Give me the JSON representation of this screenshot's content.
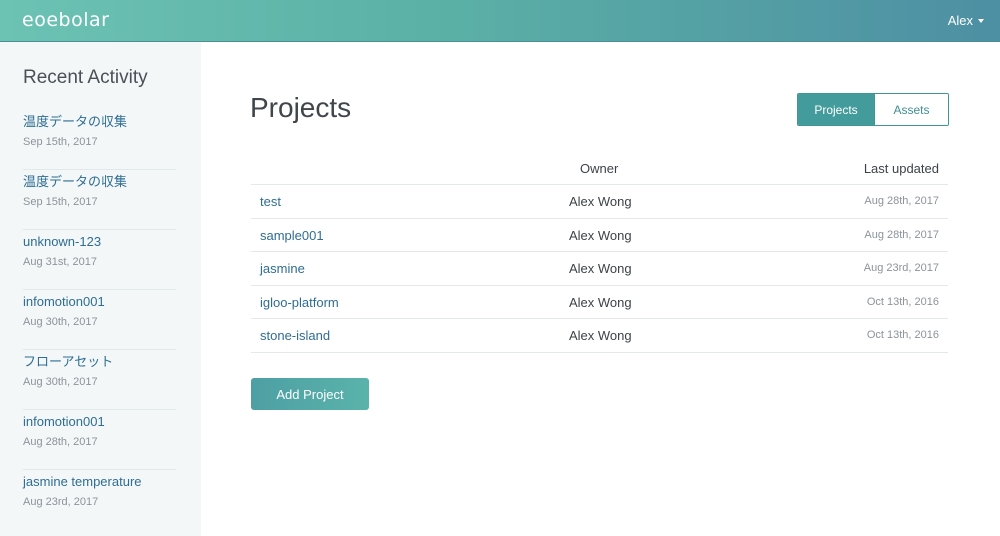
{
  "header": {
    "logo": "eoebolar",
    "user": "Alex"
  },
  "sidebar": {
    "title": "Recent Activity",
    "items": [
      {
        "name": "温度データの収集",
        "date": "Sep 15th, 2017"
      },
      {
        "name": "温度データの収集",
        "date": "Sep 15th, 2017"
      },
      {
        "name": "unknown-123",
        "date": "Aug 31st, 2017"
      },
      {
        "name": "infomotion001",
        "date": "Aug 30th, 2017"
      },
      {
        "name": "フローアセット",
        "date": "Aug 30th, 2017"
      },
      {
        "name": "infomotion001",
        "date": "Aug 28th, 2017"
      },
      {
        "name": "jasmine temperature",
        "date": "Aug 23rd, 2017"
      }
    ]
  },
  "main": {
    "title": "Projects",
    "toggle": {
      "projects": "Projects",
      "assets": "Assets",
      "active": "Projects"
    },
    "table": {
      "columns": {
        "owner": "Owner",
        "updated": "Last updated"
      },
      "rows": [
        {
          "name": "test",
          "owner": "Alex Wong",
          "updated": "Aug 28th, 2017"
        },
        {
          "name": "sample001",
          "owner": "Alex Wong",
          "updated": "Aug 28th, 2017"
        },
        {
          "name": "jasmine",
          "owner": "Alex Wong",
          "updated": "Aug 23rd, 2017"
        },
        {
          "name": "igloo-platform",
          "owner": "Alex Wong",
          "updated": "Oct 13th, 2016"
        },
        {
          "name": "stone-island",
          "owner": "Alex Wong",
          "updated": "Oct 13th, 2016"
        }
      ]
    },
    "add_button": "Add Project"
  },
  "colors": {
    "accent": "#449b9c",
    "link": "#2f6d93",
    "sidebar_bg": "#f3f7f8"
  }
}
